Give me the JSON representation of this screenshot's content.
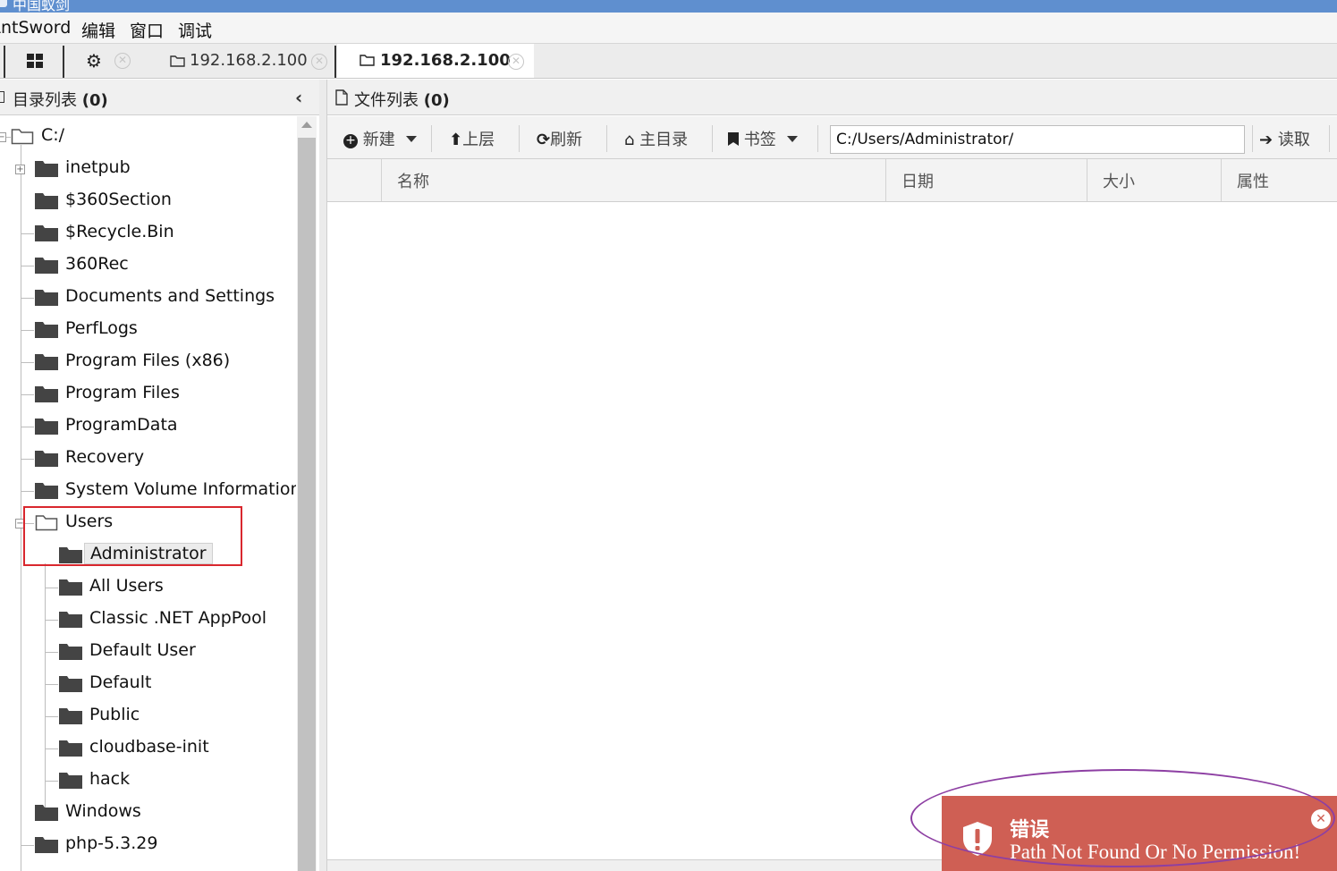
{
  "window": {
    "title": "中国蚁剑"
  },
  "menubar": {
    "items": [
      "AntSword",
      "编辑",
      "窗口",
      "调试"
    ]
  },
  "tabs": {
    "tab1_label": "192.168.2.100",
    "tab2_label": "192.168.2.100"
  },
  "left_panel": {
    "title": "目录列表",
    "count": "(0)",
    "tree": [
      {
        "label": "C:/"
      },
      {
        "label": "inetpub"
      },
      {
        "label": "$360Section"
      },
      {
        "label": "$Recycle.Bin"
      },
      {
        "label": "360Rec"
      },
      {
        "label": "Documents and Settings"
      },
      {
        "label": "PerfLogs"
      },
      {
        "label": "Program Files (x86)"
      },
      {
        "label": "Program Files"
      },
      {
        "label": "ProgramData"
      },
      {
        "label": "Recovery"
      },
      {
        "label": "System Volume Information"
      },
      {
        "label": "Users"
      },
      {
        "label": "Administrator"
      },
      {
        "label": "All Users"
      },
      {
        "label": "Classic .NET AppPool"
      },
      {
        "label": "Default User"
      },
      {
        "label": "Default"
      },
      {
        "label": "Public"
      },
      {
        "label": "cloudbase-init"
      },
      {
        "label": "hack"
      },
      {
        "label": "Windows"
      },
      {
        "label": "php-5.3.29"
      }
    ]
  },
  "right_panel": {
    "title": "文件列表",
    "count": "(0)",
    "toolbar": {
      "new_label": "新建",
      "up_label": "上层",
      "refresh_label": "刷新",
      "home_label": "主目录",
      "bookmark_label": "书签",
      "path_value": "C:/Users/Administrator/",
      "read_label": "读取"
    },
    "columns": [
      "名称",
      "日期",
      "大小",
      "属性"
    ]
  },
  "toast": {
    "title": "错误",
    "message": "Path Not Found Or No Permission!",
    "color": "#cf5f54"
  },
  "colors": {
    "highlight_box": "#d9272e",
    "oval": "#8d3fa3",
    "titlebar": "#5f8fcf"
  }
}
